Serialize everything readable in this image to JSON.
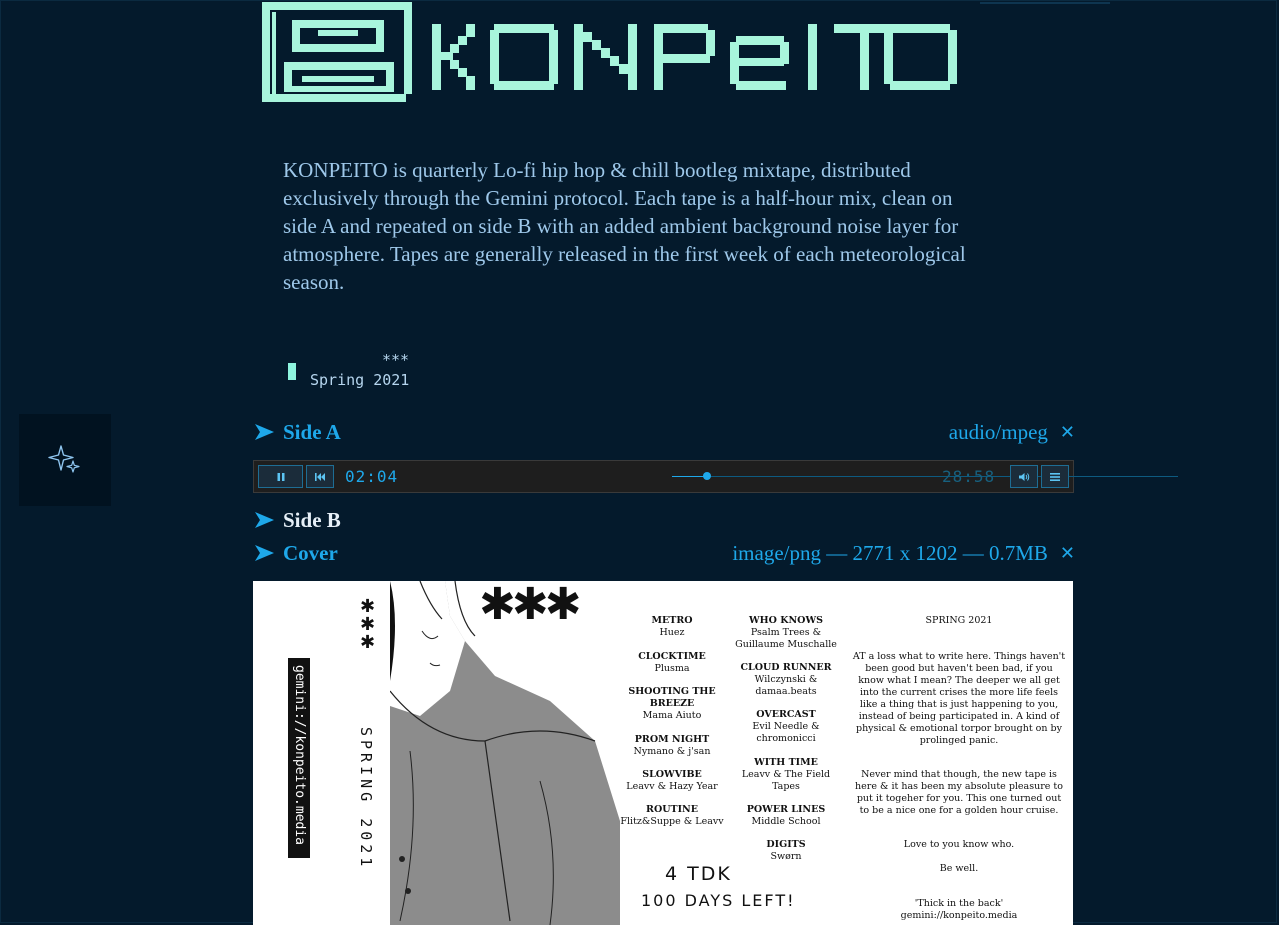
{
  "site": {
    "logo_text": "KONPEITO",
    "accent_color": "#a8f5dc"
  },
  "intro": {
    "text": "KONPEITO is quarterly Lo-fi hip hop & chill bootleg mixtape, distributed exclusively through the Gemini protocol. Each tape is a half-hour mix, clean on side A and repeated on side B with an added ambient background noise layer for atmosphere. Tapes are generally released in the first week of each meteorological season."
  },
  "preformatted": {
    "line1": "***",
    "line2": "Spring 2021"
  },
  "side_button": {
    "icon": "sparkle-icon"
  },
  "links": {
    "side_a": {
      "label": "Side A",
      "mime": "audio/mpeg"
    },
    "side_b": {
      "label": "Side B"
    },
    "cover": {
      "label": "Cover",
      "meta": "image/png — 2771 x 1202 — 0.7MB"
    }
  },
  "player": {
    "current_time": "02:04",
    "total_time": "28:58",
    "progress": 0.07
  },
  "cover_art": {
    "url": "gemini://konpeito.media",
    "season_text": "SPRING 2021",
    "tracklist_col1": [
      {
        "title": "METRO",
        "artist": "Huez"
      },
      {
        "title": "CLOCKTIME",
        "artist": "Plusma"
      },
      {
        "title": "SHOOTING THE BREEZE",
        "artist": "Mama Aiuto"
      },
      {
        "title": "PROM NIGHT",
        "artist": "Nymano & j'san"
      },
      {
        "title": "SLOWVIBE",
        "artist": "Leavv & Hazy Year"
      },
      {
        "title": "ROUTINE",
        "artist": "Flitz&Suppe & Leavv"
      }
    ],
    "tracklist_col2": [
      {
        "title": "WHO KNOWS",
        "artist": "Psalm Trees & Guillaume Muschalle"
      },
      {
        "title": "CLOUD RUNNER",
        "artist": "Wilczynski & damaa.beats"
      },
      {
        "title": "OVERCAST",
        "artist": "Evil Needle & chromonicci"
      },
      {
        "title": "WITH TIME",
        "artist": "Leavv & The Field Tapes"
      },
      {
        "title": "POWER LINES",
        "artist": "Middle School"
      },
      {
        "title": "DIGITS",
        "artist": "Swørn"
      }
    ],
    "notes_title": "SPRING 2021",
    "notes_p1": "AT a loss what to write here. Things haven't been good but haven't been bad, if you know what I mean? The deeper we all get into the current crises the more life feels like a thing that is just happening to you, instead of being participated in. A kind of physical & emotional torpor brought on by prolinged panic.",
    "notes_p2": "Never mind that though, the new tape is here & it has been my absolute pleasure to put it togeher for you. This one turned out to be a nice one for a golden hour cruise.",
    "notes_p3": "Love to you know who.",
    "notes_p4": "Be well.",
    "notes_p5": "'Thick in the back'",
    "notes_p6": "gemini://konpeito.media",
    "handwritten_1": "4 TDK",
    "handwritten_2": "100 DAYS LEFT!"
  }
}
